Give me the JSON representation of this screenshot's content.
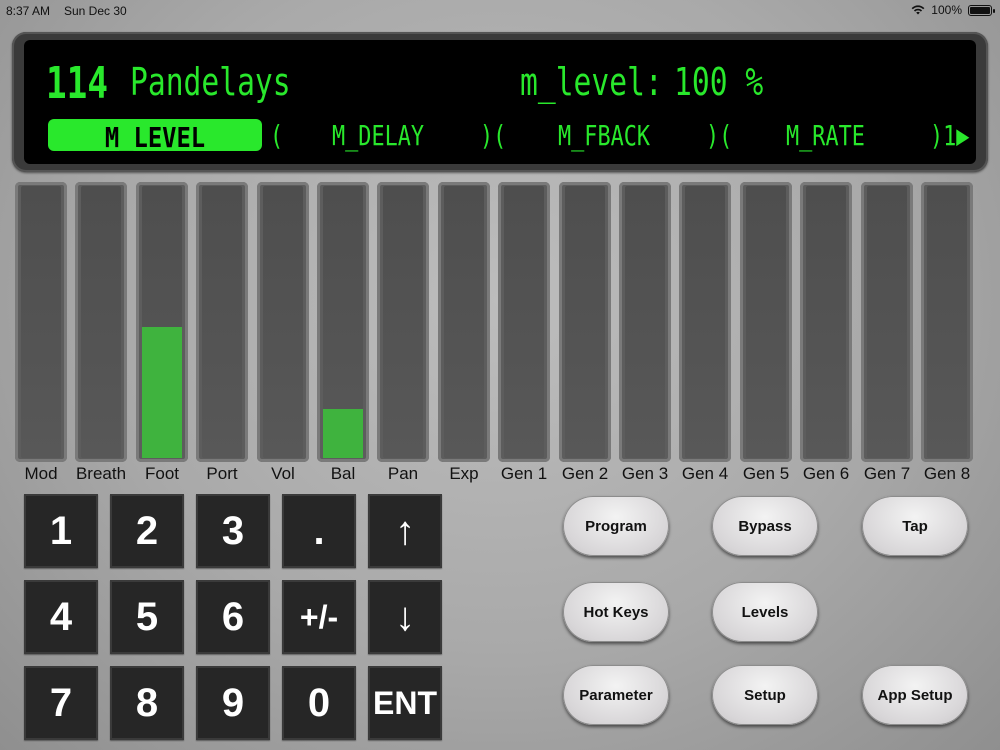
{
  "status_bar": {
    "time": "8:37 AM",
    "date": "Sun Dec 30",
    "battery": "100%"
  },
  "display": {
    "program_number": "114",
    "program_name": "Pandelays",
    "param_name": "m_level:",
    "param_value": "100 %",
    "soft_buttons": [
      {
        "label": "M_LEVEL",
        "selected": true
      },
      {
        "label": "M_DELAY",
        "selected": false
      },
      {
        "label": "M_FBACK",
        "selected": false
      },
      {
        "label": "M_RATE",
        "selected": false
      }
    ],
    "separators": [
      "(",
      ")(",
      ")(",
      ")1▶"
    ]
  },
  "meters": [
    {
      "label": "Mod",
      "level": 0
    },
    {
      "label": "Breath",
      "level": 0
    },
    {
      "label": "Foot",
      "level": 0.48
    },
    {
      "label": "Port",
      "level": 0
    },
    {
      "label": "Vol",
      "level": 0
    },
    {
      "label": "Bal",
      "level": 0.18
    },
    {
      "label": "Pan",
      "level": 0
    },
    {
      "label": "Exp",
      "level": 0
    },
    {
      "label": "Gen 1",
      "level": 0
    },
    {
      "label": "Gen 2",
      "level": 0
    },
    {
      "label": "Gen 3",
      "level": 0
    },
    {
      "label": "Gen 4",
      "level": 0
    },
    {
      "label": "Gen 5",
      "level": 0
    },
    {
      "label": "Gen 6",
      "level": 0
    },
    {
      "label": "Gen 7",
      "level": 0
    },
    {
      "label": "Gen 8",
      "level": 0
    }
  ],
  "keypad": [
    [
      "1",
      "2",
      "3",
      ".",
      "↑"
    ],
    [
      "4",
      "5",
      "6",
      "+/-",
      "↓"
    ],
    [
      "7",
      "8",
      "9",
      "0",
      "ENT"
    ]
  ],
  "buttons": {
    "program": "Program",
    "bypass": "Bypass",
    "tap": "Tap",
    "hot_keys": "Hot Keys",
    "levels": "Levels",
    "parameter": "Parameter",
    "setup": "Setup",
    "app_setup": "App Setup"
  },
  "colors": {
    "lcd_green": "#29e82c",
    "meter_fill": "#3fb33e"
  }
}
